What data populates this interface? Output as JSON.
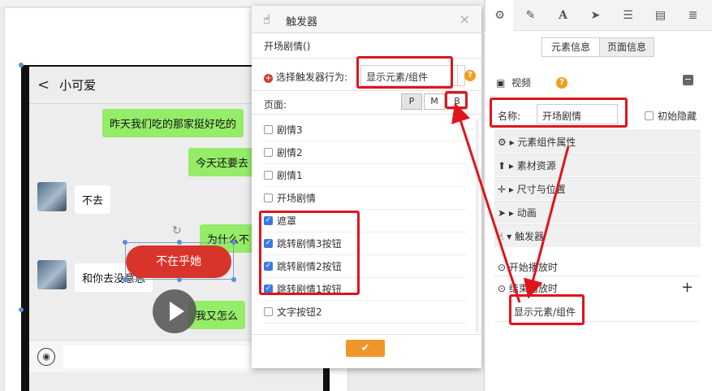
{
  "chat": {
    "title": "小可爱",
    "back": "<",
    "messages": [
      {
        "text": "昨天我们吃的那家挺好吃的"
      },
      {
        "text": "今天还要去"
      },
      {
        "text": "不去"
      },
      {
        "text": "为什么不"
      },
      {
        "text": "和你去没意思"
      },
      {
        "text": "我又怎么"
      }
    ],
    "red_button": "不在乎她",
    "voice_icon": "voice-icon"
  },
  "dialog": {
    "title": "触发器",
    "subtitle": "开场剧情()",
    "behavior_label": "选择触发器行为:",
    "behavior_value": "显示元素/组件",
    "page_label": "页面:",
    "page_buttons": [
      "P",
      "M",
      "B"
    ],
    "items": [
      {
        "label": "剧情3",
        "checked": false
      },
      {
        "label": "剧情2",
        "checked": false
      },
      {
        "label": "剧情1",
        "checked": false
      },
      {
        "label": "开场剧情",
        "checked": false
      },
      {
        "label": "遮罩",
        "checked": true
      },
      {
        "label": "跳转剧情3按钮",
        "checked": true
      },
      {
        "label": "跳转剧情2按钮",
        "checked": true
      },
      {
        "label": "跳转剧情1按钮",
        "checked": true
      },
      {
        "label": "文字按钮2",
        "checked": false
      }
    ],
    "ok": "✔"
  },
  "panel": {
    "segments": [
      "元素信息",
      "页面信息"
    ],
    "section": "视频",
    "name_label": "名称:",
    "name_value": "开场剧情",
    "hide_label": "初始隐藏",
    "accordion": [
      "元素组件属性",
      "素材资源",
      "尺寸与位置",
      "动画",
      "触发器"
    ],
    "events": [
      "开始播放时",
      "结束播放时"
    ],
    "action": "显示元素/组件"
  },
  "colors": {
    "highlight": "#e0141c",
    "accent": "#f0952a",
    "chat_green": "#95ec69"
  }
}
